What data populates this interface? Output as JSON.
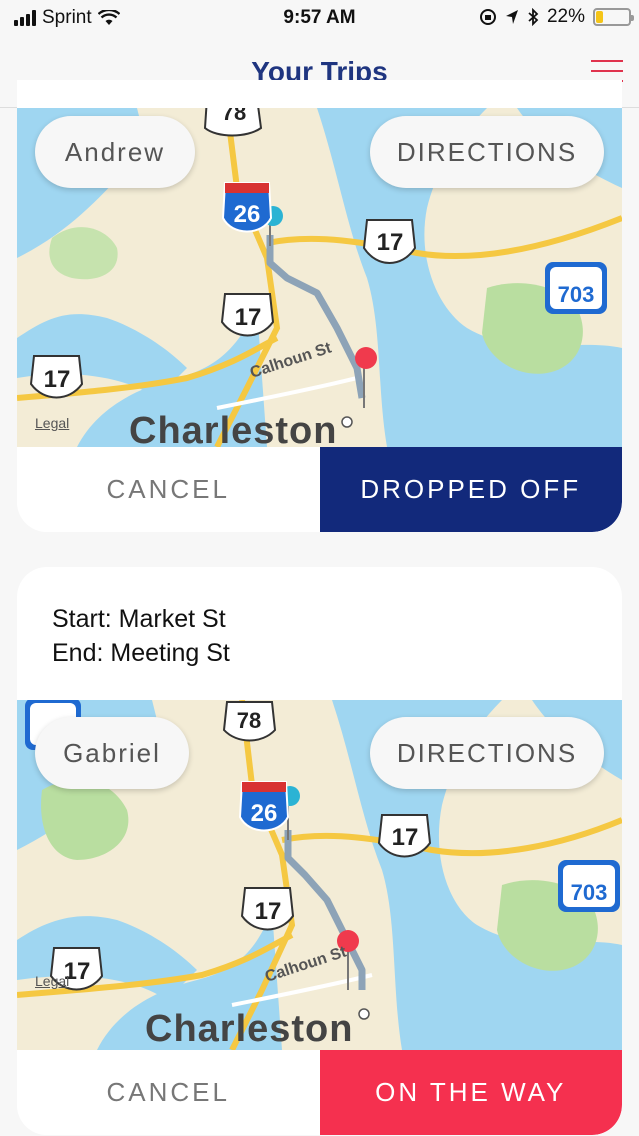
{
  "status_bar": {
    "carrier": "Sprint",
    "time": "9:57 AM",
    "battery_percent": "22%",
    "battery_level": 0.22,
    "icons": [
      "signal-icon",
      "wifi-icon",
      "lock-rotation-icon",
      "location-arrow-icon",
      "bluetooth-icon",
      "battery-icon"
    ]
  },
  "header": {
    "title": "Your Trips",
    "menu_icon": "hamburger-menu-icon"
  },
  "colors": {
    "brand_navy": "#12297b",
    "accent_red": "#f5304f",
    "title_blue": "#1f3580"
  },
  "trips": [
    {
      "rider_name": "Andrew",
      "directions_label": "DIRECTIONS",
      "cancel_label": "CANCEL",
      "status_label": "DROPPED OFF",
      "map": {
        "legal": "Legal",
        "city": "Charleston",
        "street": "Calhoun St",
        "shields": [
          "78",
          "26",
          "17",
          "17",
          "17",
          "703"
        ]
      }
    },
    {
      "start_label": "Start: Market St",
      "end_label": "End: Meeting St",
      "rider_name": "Gabriel",
      "directions_label": "DIRECTIONS",
      "cancel_label": "CANCEL",
      "status_label": "ON THE WAY",
      "map": {
        "legal": "Legal",
        "city": "Charleston",
        "street": "Calhoun St",
        "shields": [
          "78",
          "26",
          "17",
          "17",
          "17",
          "703"
        ]
      }
    }
  ]
}
